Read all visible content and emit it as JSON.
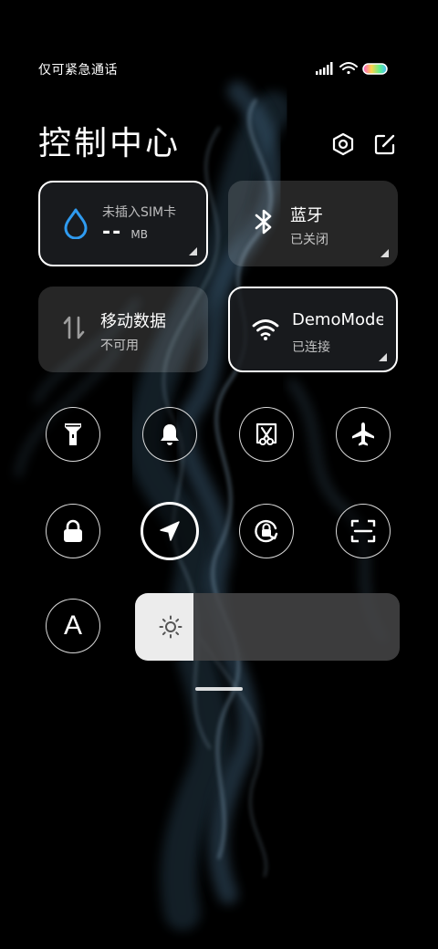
{
  "status_bar": {
    "carrier_text": "仅可紧急通话",
    "signal_icon": "signal-icon",
    "wifi_icon": "wifi-icon",
    "battery_icon": "battery-icon"
  },
  "header": {
    "title": "控制中心",
    "settings_icon": "settings-hexagon-icon",
    "edit_icon": "edit-icon"
  },
  "tiles": {
    "data_usage": {
      "label": "未插入SIM卡",
      "value": "--",
      "unit": "MB",
      "icon": "water-drop-icon",
      "accent": "#2f9bf0"
    },
    "bluetooth": {
      "label": "蓝牙",
      "status": "已关闭",
      "icon": "bluetooth-icon"
    },
    "mobile_data": {
      "label": "移动数据",
      "status": "不可用",
      "icon": "data-arrows-icon"
    },
    "wifi": {
      "label": "DemoMode",
      "status": "已连接",
      "icon": "wifi-icon"
    }
  },
  "toggles": [
    {
      "name": "flashlight",
      "icon": "flashlight-icon",
      "active": false
    },
    {
      "name": "ring",
      "icon": "bell-icon",
      "active": false
    },
    {
      "name": "screenshot",
      "icon": "scissors-icon",
      "active": false
    },
    {
      "name": "airplane-mode",
      "icon": "airplane-icon",
      "active": false
    },
    {
      "name": "lock-screen",
      "icon": "lock-icon",
      "active": false
    },
    {
      "name": "location",
      "icon": "location-arrow-icon",
      "active": true
    },
    {
      "name": "rotation-lock",
      "icon": "rotation-lock-icon",
      "active": false
    },
    {
      "name": "scanner",
      "icon": "scan-icon",
      "active": false
    }
  ],
  "font_toggle": {
    "label": "A",
    "icon": "font-size-icon"
  },
  "brightness": {
    "level": 0.22,
    "icon": "brightness-sun-icon"
  },
  "colors": {
    "tile_active_border": "#ffffff",
    "tile_bg": "#3a3a3c",
    "accent": "#2f9bf0"
  }
}
